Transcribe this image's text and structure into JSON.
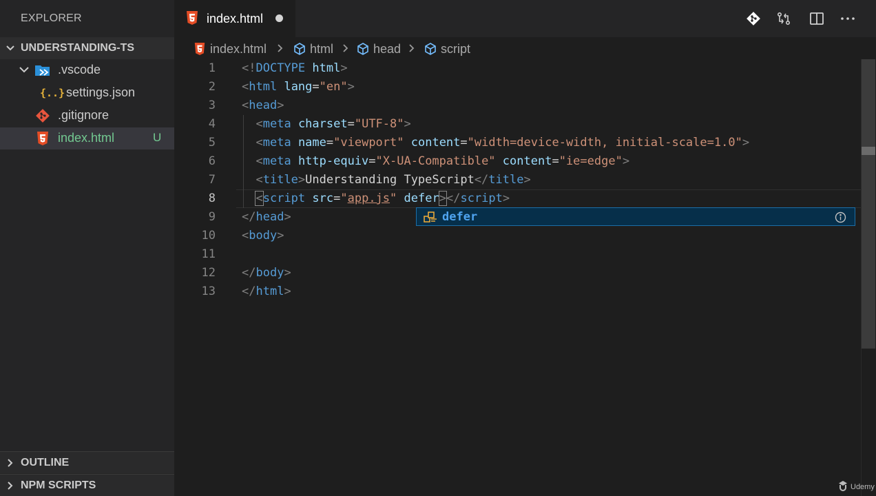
{
  "sidebar": {
    "title": "EXPLORER",
    "project": "UNDERSTANDING-TS",
    "items": [
      {
        "label": ".vscode",
        "icon": "vscode-folder-icon"
      },
      {
        "label": "settings.json",
        "icon": "json-icon",
        "glyph": "{..}"
      },
      {
        "label": ".gitignore",
        "icon": "git-icon"
      },
      {
        "label": "index.html",
        "icon": "html5-icon",
        "badge": "U"
      }
    ],
    "outline": "OUTLINE",
    "npm_scripts": "NPM SCRIPTS"
  },
  "tab": {
    "label": "index.html",
    "modified": true
  },
  "breadcrumb": [
    "index.html",
    "html",
    "head",
    "script"
  ],
  "editor": {
    "line_numbers": [
      "1",
      "2",
      "3",
      "4",
      "5",
      "6",
      "7",
      "8",
      "9",
      "10",
      "11",
      "12",
      "13"
    ],
    "active_line": 8,
    "lines": [
      [
        {
          "c": "p",
          "t": "<!"
        },
        {
          "c": "t",
          "t": "DOCTYPE"
        },
        {
          "c": "x",
          "t": " "
        },
        {
          "c": "a",
          "t": "html"
        },
        {
          "c": "p",
          "t": ">"
        }
      ],
      [
        {
          "c": "p",
          "t": "<"
        },
        {
          "c": "t",
          "t": "html"
        },
        {
          "c": "x",
          "t": " "
        },
        {
          "c": "a",
          "t": "lang"
        },
        {
          "c": "x",
          "t": "="
        },
        {
          "c": "s",
          "t": "\"en\""
        },
        {
          "c": "p",
          "t": ">"
        }
      ],
      [
        {
          "c": "p",
          "t": "<"
        },
        {
          "c": "t",
          "t": "head"
        },
        {
          "c": "p",
          "t": ">"
        }
      ],
      [
        {
          "c": "x",
          "t": "  "
        },
        {
          "c": "p",
          "t": "<"
        },
        {
          "c": "t",
          "t": "meta"
        },
        {
          "c": "x",
          "t": " "
        },
        {
          "c": "a",
          "t": "charset"
        },
        {
          "c": "x",
          "t": "="
        },
        {
          "c": "s",
          "t": "\"UTF-8\""
        },
        {
          "c": "p",
          "t": ">"
        }
      ],
      [
        {
          "c": "x",
          "t": "  "
        },
        {
          "c": "p",
          "t": "<"
        },
        {
          "c": "t",
          "t": "meta"
        },
        {
          "c": "x",
          "t": " "
        },
        {
          "c": "a",
          "t": "name"
        },
        {
          "c": "x",
          "t": "="
        },
        {
          "c": "s",
          "t": "\"viewport\""
        },
        {
          "c": "x",
          "t": " "
        },
        {
          "c": "a",
          "t": "content"
        },
        {
          "c": "x",
          "t": "="
        },
        {
          "c": "s",
          "t": "\"width=device-width, initial-scale=1.0\""
        },
        {
          "c": "p",
          "t": ">"
        }
      ],
      [
        {
          "c": "x",
          "t": "  "
        },
        {
          "c": "p",
          "t": "<"
        },
        {
          "c": "t",
          "t": "meta"
        },
        {
          "c": "x",
          "t": " "
        },
        {
          "c": "a",
          "t": "http-equiv"
        },
        {
          "c": "x",
          "t": "="
        },
        {
          "c": "s",
          "t": "\"X-UA-Compatible\""
        },
        {
          "c": "x",
          "t": " "
        },
        {
          "c": "a",
          "t": "content"
        },
        {
          "c": "x",
          "t": "="
        },
        {
          "c": "s",
          "t": "\"ie=edge\""
        },
        {
          "c": "p",
          "t": ">"
        }
      ],
      [
        {
          "c": "x",
          "t": "  "
        },
        {
          "c": "p",
          "t": "<"
        },
        {
          "c": "t",
          "t": "title"
        },
        {
          "c": "p",
          "t": ">"
        },
        {
          "c": "x",
          "t": "Understanding TypeScript"
        },
        {
          "c": "p",
          "t": "</"
        },
        {
          "c": "t",
          "t": "title"
        },
        {
          "c": "p",
          "t": ">"
        }
      ],
      [
        {
          "c": "x",
          "t": "  "
        },
        {
          "c": "p bracket",
          "t": "<"
        },
        {
          "c": "t",
          "t": "script"
        },
        {
          "c": "x",
          "t": " "
        },
        {
          "c": "a",
          "t": "src"
        },
        {
          "c": "x",
          "t": "="
        },
        {
          "c": "s",
          "t": "\""
        },
        {
          "c": "s u",
          "t": "app.js"
        },
        {
          "c": "s",
          "t": "\""
        },
        {
          "c": "x",
          "t": " "
        },
        {
          "c": "a",
          "t": "defer"
        },
        {
          "c": "p bracket",
          "t": ">"
        },
        {
          "c": "p",
          "t": "</"
        },
        {
          "c": "t",
          "t": "script"
        },
        {
          "c": "p",
          "t": ">"
        }
      ],
      [
        {
          "c": "p",
          "t": "</"
        },
        {
          "c": "t",
          "t": "head"
        },
        {
          "c": "p",
          "t": ">"
        }
      ],
      [
        {
          "c": "p",
          "t": "<"
        },
        {
          "c": "t",
          "t": "body"
        },
        {
          "c": "p",
          "t": ">"
        }
      ],
      [],
      [
        {
          "c": "p",
          "t": "</"
        },
        {
          "c": "t",
          "t": "body"
        },
        {
          "c": "p",
          "t": ">"
        }
      ],
      [
        {
          "c": "p",
          "t": "</"
        },
        {
          "c": "t",
          "t": "html"
        },
        {
          "c": "p",
          "t": ">"
        }
      ]
    ]
  },
  "suggest": {
    "label": "defer",
    "icon": "property-icon",
    "info_icon": "info-icon"
  },
  "actions": [
    "git-icon",
    "compare-changes-icon",
    "split-editor-icon",
    "more-actions-icon"
  ],
  "watermark": "Udemy",
  "colors": {
    "sidebar_bg": "#252526",
    "editor_bg": "#1e1e1e",
    "html_icon": "#e44d26",
    "untracked": "#73c991",
    "suggest_bg": "#062f4a",
    "suggest_text": "#4fa3ef"
  }
}
